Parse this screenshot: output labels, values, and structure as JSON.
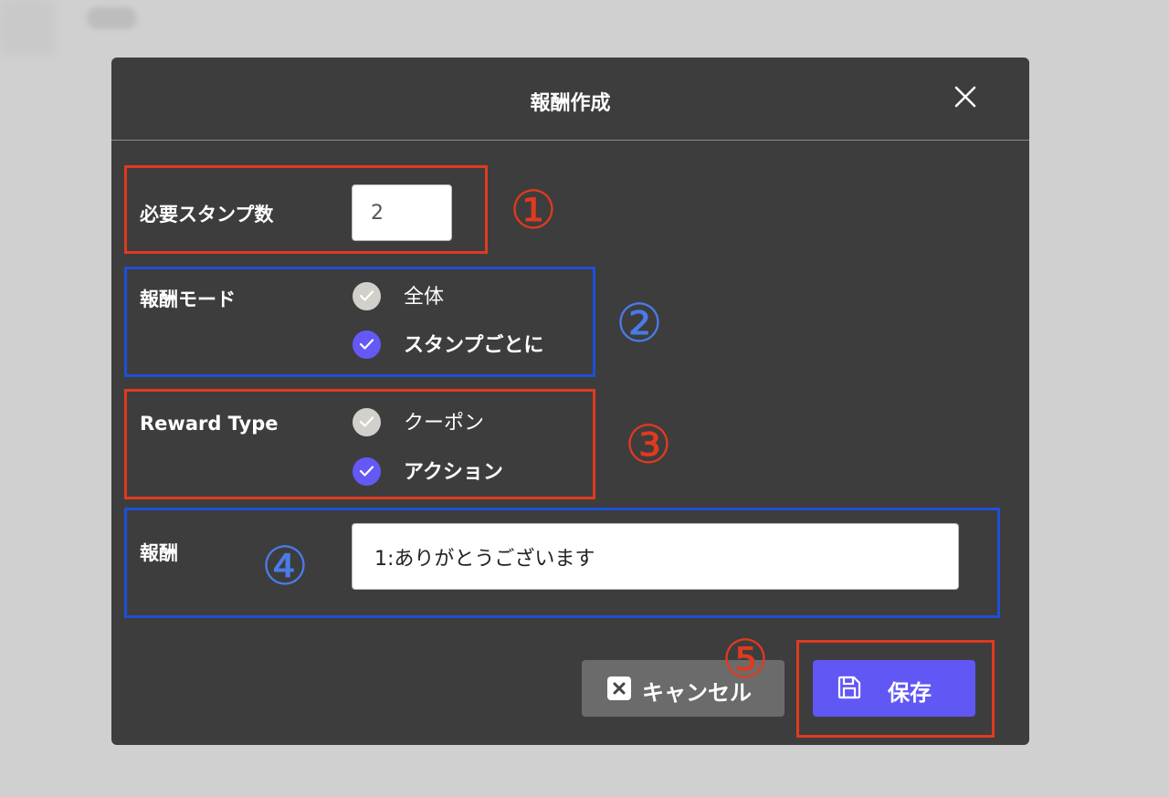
{
  "modal": {
    "title": "報酬作成",
    "close_icon": "close-icon"
  },
  "stamps": {
    "label": "必要スタンプ数",
    "value": "2"
  },
  "reward_mode": {
    "label": "報酬モード",
    "options": [
      {
        "label": "全体",
        "checked": false
      },
      {
        "label": "スタンプごとに",
        "checked": true
      }
    ]
  },
  "reward_type": {
    "label": "Reward Type",
    "options": [
      {
        "label": "クーポン",
        "checked": false
      },
      {
        "label": "アクション",
        "checked": true
      }
    ]
  },
  "reward": {
    "label": "報酬",
    "value": "1:ありがとうございます"
  },
  "buttons": {
    "cancel_label": "キャンセル",
    "save_label": "保存"
  },
  "annotations": [
    "①",
    "②",
    "③",
    "④",
    "⑤"
  ],
  "colors": {
    "modal_bg": "#3d3d3d",
    "accent": "#6157f5",
    "annotation_red": "#e03a1e",
    "annotation_blue": "#1e4fd6"
  }
}
